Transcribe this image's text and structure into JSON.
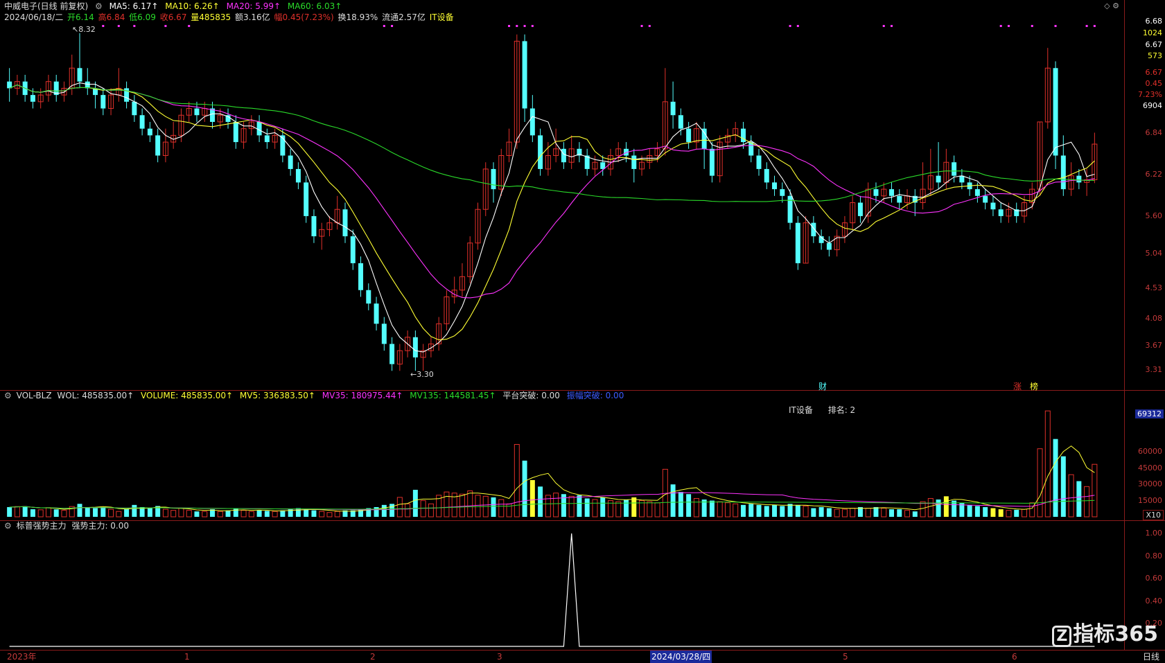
{
  "main_header": {
    "stock_name": "中威电子(日线 前复权)",
    "ma5": "MA5: 6.17↑",
    "ma10": "MA10: 6.26↑",
    "ma20": "MA20: 5.99↑",
    "ma60": "MA60: 6.03↑",
    "date": "2024/06/18/二",
    "open": "开6.14",
    "high": "高6.84",
    "low": "低6.09",
    "close": "收6.67",
    "volume": "量485835",
    "amount": "额3.16亿",
    "change": "幅0.45(7.23%)",
    "turnover": "换18.93%",
    "float": "流通2.57亿",
    "sector": "IT设备"
  },
  "vol_header": {
    "name": "VOL-BLZ",
    "wol": "WOL: 485835.00↑",
    "volume": "VOLUME: 485835.00↑",
    "mv5": "MV5: 336383.50↑",
    "mv35": "MV35: 180975.44↑",
    "mv135": "MV135: 144581.45↑",
    "platform": "平台突破: 0.00",
    "other": "振幅突破: 0.00"
  },
  "vol_note": {
    "sector": "IT设备",
    "rank": "排名: 2"
  },
  "ind_header": {
    "name": "标普强势主力",
    "value": "强势主力: 0.00"
  },
  "annotations": {
    "high": "8.32",
    "low": "3.30",
    "cai": "财",
    "zhang": "涨",
    "bang": "榜"
  },
  "right_axis": {
    "top_price": "6.68",
    "top_count": "1024",
    "p2": "6.67",
    "p2b": "573",
    "p3": "6.67",
    "p3b": "0.45",
    "p3c": "7.23%",
    "vol_now": "6904",
    "vol_marker": "69312",
    "vol_mult": "X10",
    "period": "日线"
  },
  "price_ticks": [
    "6.84",
    "6.22",
    "5.60",
    "5.04",
    "4.53",
    "4.08",
    "3.67",
    "3.31"
  ],
  "vol_ticks": [
    "60000",
    "45000",
    "30000",
    "15000"
  ],
  "ind_ticks": [
    "1.00",
    "0.80",
    "0.60",
    "0.40",
    "0.20"
  ],
  "time_axis": {
    "labels": [
      "2023年",
      "1",
      "2",
      "3",
      "2024/03/28/四",
      "5",
      "6"
    ]
  },
  "logo": "指标365",
  "colors": {
    "up": "#e0302a",
    "down": "#54ffff",
    "ma5": "#ffffff",
    "ma10": "#ffff33",
    "ma20": "#ff33ff",
    "ma60": "#2adb2a",
    "volyellow": "#ffff33"
  },
  "chart_data": {
    "type": "candlestick",
    "title": "中威电子(日线 前复权)",
    "ylim": [
      3.2,
      8.4
    ],
    "bars": [
      {
        "o": 7.6,
        "c": 7.5,
        "h": 7.8,
        "l": 7.3,
        "v": 9000
      },
      {
        "o": 7.5,
        "c": 7.6,
        "h": 7.7,
        "l": 7.4,
        "v": 9500
      },
      {
        "o": 7.6,
        "c": 7.4,
        "h": 7.7,
        "l": 7.3,
        "v": 9800
      },
      {
        "o": 7.4,
        "c": 7.3,
        "h": 7.5,
        "l": 7.2,
        "v": 7000
      },
      {
        "o": 7.3,
        "c": 7.4,
        "h": 7.5,
        "l": 7.2,
        "v": 6500
      },
      {
        "o": 7.4,
        "c": 7.6,
        "h": 7.7,
        "l": 7.3,
        "v": 8500
      },
      {
        "o": 7.6,
        "c": 7.4,
        "h": 7.7,
        "l": 7.3,
        "v": 6900
      },
      {
        "o": 7.4,
        "c": 7.5,
        "h": 7.6,
        "l": 7.3,
        "v": 6000
      },
      {
        "o": 7.5,
        "c": 7.8,
        "h": 8.0,
        "l": 7.4,
        "v": 9500
      },
      {
        "o": 7.8,
        "c": 7.6,
        "h": 8.32,
        "l": 7.5,
        "v": 12000
      },
      {
        "o": 7.6,
        "c": 7.5,
        "h": 7.8,
        "l": 7.4,
        "v": 9000
      },
      {
        "o": 7.5,
        "c": 7.4,
        "h": 7.6,
        "l": 7.2,
        "v": 8000
      },
      {
        "o": 7.4,
        "c": 7.2,
        "h": 7.5,
        "l": 7.1,
        "v": 9000
      },
      {
        "o": 7.2,
        "c": 7.4,
        "h": 7.5,
        "l": 7.1,
        "v": 7000
      },
      {
        "o": 7.4,
        "c": 7.5,
        "h": 7.8,
        "l": 7.3,
        "v": 5000
      },
      {
        "o": 7.5,
        "c": 7.3,
        "h": 7.6,
        "l": 7.2,
        "v": 7000
      },
      {
        "o": 7.3,
        "c": 7.1,
        "h": 7.4,
        "l": 7.0,
        "v": 11000
      },
      {
        "o": 7.1,
        "c": 6.9,
        "h": 7.2,
        "l": 6.8,
        "v": 9000
      },
      {
        "o": 6.9,
        "c": 6.8,
        "h": 7.0,
        "l": 6.7,
        "v": 8000
      },
      {
        "o": 6.8,
        "c": 6.5,
        "h": 6.9,
        "l": 6.4,
        "v": 10000
      },
      {
        "o": 6.5,
        "c": 6.7,
        "h": 6.9,
        "l": 6.4,
        "v": 7000
      },
      {
        "o": 6.7,
        "c": 6.8,
        "h": 7.0,
        "l": 6.6,
        "v": 6000
      },
      {
        "o": 6.8,
        "c": 7.1,
        "h": 7.2,
        "l": 6.7,
        "v": 8000
      },
      {
        "o": 7.1,
        "c": 7.2,
        "h": 7.3,
        "l": 7.0,
        "v": 6000
      },
      {
        "o": 7.2,
        "c": 7.1,
        "h": 7.3,
        "l": 7.0,
        "v": 5000
      },
      {
        "o": 7.1,
        "c": 7.2,
        "h": 7.3,
        "l": 7.0,
        "v": 5000
      },
      {
        "o": 7.2,
        "c": 7.0,
        "h": 7.3,
        "l": 6.9,
        "v": 7000
      },
      {
        "o": 7.0,
        "c": 7.1,
        "h": 7.2,
        "l": 6.9,
        "v": 5000
      },
      {
        "o": 7.1,
        "c": 7.0,
        "h": 7.2,
        "l": 6.9,
        "v": 6000
      },
      {
        "o": 7.0,
        "c": 6.7,
        "h": 7.1,
        "l": 6.6,
        "v": 8000
      },
      {
        "o": 6.7,
        "c": 6.9,
        "h": 7.0,
        "l": 6.6,
        "v": 6000
      },
      {
        "o": 6.9,
        "c": 7.0,
        "h": 7.1,
        "l": 6.8,
        "v": 5000
      },
      {
        "o": 7.0,
        "c": 6.8,
        "h": 7.1,
        "l": 6.7,
        "v": 6000
      },
      {
        "o": 6.8,
        "c": 6.7,
        "h": 6.9,
        "l": 6.6,
        "v": 5500
      },
      {
        "o": 6.7,
        "c": 6.8,
        "h": 6.9,
        "l": 6.6,
        "v": 5000
      },
      {
        "o": 6.8,
        "c": 6.5,
        "h": 6.9,
        "l": 6.4,
        "v": 6000
      },
      {
        "o": 6.5,
        "c": 6.3,
        "h": 6.6,
        "l": 6.2,
        "v": 7000
      },
      {
        "o": 6.3,
        "c": 6.1,
        "h": 6.4,
        "l": 6.0,
        "v": 8000
      },
      {
        "o": 6.1,
        "c": 5.6,
        "h": 6.2,
        "l": 5.5,
        "v": 7000
      },
      {
        "o": 5.6,
        "c": 5.3,
        "h": 5.7,
        "l": 5.2,
        "v": 6000
      },
      {
        "o": 5.3,
        "c": 5.4,
        "h": 5.5,
        "l": 5.1,
        "v": 5000
      },
      {
        "o": 5.4,
        "c": 5.5,
        "h": 5.6,
        "l": 5.3,
        "v": 4000
      },
      {
        "o": 5.5,
        "c": 5.7,
        "h": 5.9,
        "l": 5.4,
        "v": 5000
      },
      {
        "o": 5.7,
        "c": 5.3,
        "h": 5.8,
        "l": 5.2,
        "v": 6000
      },
      {
        "o": 5.3,
        "c": 4.9,
        "h": 5.4,
        "l": 4.8,
        "v": 6000
      },
      {
        "o": 4.9,
        "c": 4.5,
        "h": 5.0,
        "l": 4.4,
        "v": 7000
      },
      {
        "o": 4.5,
        "c": 4.3,
        "h": 4.6,
        "l": 4.2,
        "v": 8000
      },
      {
        "o": 4.3,
        "c": 4.0,
        "h": 4.4,
        "l": 3.9,
        "v": 9000
      },
      {
        "o": 4.0,
        "c": 3.7,
        "h": 4.1,
        "l": 3.6,
        "v": 11000
      },
      {
        "o": 3.7,
        "c": 3.4,
        "h": 3.8,
        "l": 3.3,
        "v": 12000
      },
      {
        "o": 3.4,
        "c": 3.6,
        "h": 3.7,
        "l": 3.3,
        "v": 18000
      },
      {
        "o": 3.6,
        "c": 3.8,
        "h": 3.9,
        "l": 3.5,
        "v": 12000
      },
      {
        "o": 3.8,
        "c": 3.5,
        "h": 3.9,
        "l": 3.3,
        "v": 25000
      },
      {
        "o": 3.5,
        "c": 3.6,
        "h": 3.7,
        "l": 3.3,
        "v": 15000
      },
      {
        "o": 3.6,
        "c": 3.7,
        "h": 3.8,
        "l": 3.5,
        "v": 12000
      },
      {
        "o": 3.7,
        "c": 4.0,
        "h": 4.1,
        "l": 3.6,
        "v": 20000
      },
      {
        "o": 4.0,
        "c": 4.4,
        "h": 4.5,
        "l": 3.9,
        "v": 23000
      },
      {
        "o": 4.4,
        "c": 4.5,
        "h": 4.7,
        "l": 4.3,
        "v": 22000
      },
      {
        "o": 4.5,
        "c": 4.7,
        "h": 4.9,
        "l": 4.4,
        "v": 21000
      },
      {
        "o": 4.7,
        "c": 5.2,
        "h": 5.3,
        "l": 4.6,
        "v": 24000
      },
      {
        "o": 5.2,
        "c": 5.7,
        "h": 5.8,
        "l": 5.1,
        "v": 20000
      },
      {
        "o": 5.7,
        "c": 6.3,
        "h": 6.4,
        "l": 5.6,
        "v": 19000
      },
      {
        "o": 6.3,
        "c": 6.0,
        "h": 6.4,
        "l": 5.8,
        "v": 18000
      },
      {
        "o": 6.0,
        "c": 6.5,
        "h": 6.6,
        "l": 5.9,
        "v": 16000
      },
      {
        "o": 6.5,
        "c": 6.7,
        "h": 6.9,
        "l": 6.4,
        "v": 12000
      },
      {
        "o": 6.7,
        "c": 8.2,
        "h": 8.3,
        "l": 6.6,
        "v": 67000
      },
      {
        "o": 8.2,
        "c": 7.2,
        "h": 8.3,
        "l": 7.0,
        "v": 52000
      },
      {
        "o": 7.2,
        "c": 6.8,
        "h": 7.4,
        "l": 6.7,
        "v": 34000
      },
      {
        "o": 6.8,
        "c": 6.3,
        "h": 6.9,
        "l": 6.2,
        "v": 28000
      },
      {
        "o": 6.3,
        "c": 6.5,
        "h": 6.7,
        "l": 6.2,
        "v": 20000
      },
      {
        "o": 6.5,
        "c": 6.6,
        "h": 6.9,
        "l": 6.4,
        "v": 22000
      },
      {
        "o": 6.6,
        "c": 6.4,
        "h": 6.7,
        "l": 6.3,
        "v": 21000
      },
      {
        "o": 6.4,
        "c": 6.6,
        "h": 6.8,
        "l": 6.3,
        "v": 19000
      },
      {
        "o": 6.6,
        "c": 6.5,
        "h": 6.7,
        "l": 6.4,
        "v": 20000
      },
      {
        "o": 6.5,
        "c": 6.3,
        "h": 6.6,
        "l": 6.2,
        "v": 17000
      },
      {
        "o": 6.3,
        "c": 6.4,
        "h": 6.5,
        "l": 6.2,
        "v": 16000
      },
      {
        "o": 6.4,
        "c": 6.3,
        "h": 6.5,
        "l": 6.2,
        "v": 18000
      },
      {
        "o": 6.3,
        "c": 6.5,
        "h": 6.6,
        "l": 6.2,
        "v": 15000
      },
      {
        "o": 6.5,
        "c": 6.6,
        "h": 6.7,
        "l": 6.4,
        "v": 14000
      },
      {
        "o": 6.6,
        "c": 6.5,
        "h": 6.7,
        "l": 6.4,
        "v": 16000
      },
      {
        "o": 6.5,
        "c": 6.3,
        "h": 6.6,
        "l": 6.1,
        "v": 18000
      },
      {
        "o": 6.3,
        "c": 6.4,
        "h": 6.5,
        "l": 6.2,
        "v": 15000
      },
      {
        "o": 6.4,
        "c": 6.5,
        "h": 6.6,
        "l": 6.3,
        "v": 14000
      },
      {
        "o": 6.5,
        "c": 6.6,
        "h": 6.7,
        "l": 6.4,
        "v": 13000
      },
      {
        "o": 6.6,
        "c": 7.3,
        "h": 7.8,
        "l": 6.5,
        "v": 44000
      },
      {
        "o": 7.3,
        "c": 7.1,
        "h": 7.6,
        "l": 6.9,
        "v": 30000
      },
      {
        "o": 7.1,
        "c": 6.9,
        "h": 7.2,
        "l": 6.8,
        "v": 23000
      },
      {
        "o": 6.9,
        "c": 6.7,
        "h": 7.0,
        "l": 6.6,
        "v": 21000
      },
      {
        "o": 6.7,
        "c": 6.9,
        "h": 7.0,
        "l": 6.6,
        "v": 17000
      },
      {
        "o": 6.9,
        "c": 6.6,
        "h": 7.0,
        "l": 6.3,
        "v": 16000
      },
      {
        "o": 6.6,
        "c": 6.2,
        "h": 6.7,
        "l": 6.1,
        "v": 15000
      },
      {
        "o": 6.2,
        "c": 6.7,
        "h": 6.8,
        "l": 6.1,
        "v": 14000
      },
      {
        "o": 6.7,
        "c": 6.8,
        "h": 6.9,
        "l": 6.6,
        "v": 13000
      },
      {
        "o": 6.8,
        "c": 6.9,
        "h": 7.0,
        "l": 6.7,
        "v": 12000
      },
      {
        "o": 6.9,
        "c": 6.7,
        "h": 7.0,
        "l": 6.6,
        "v": 11000
      },
      {
        "o": 6.7,
        "c": 6.5,
        "h": 6.8,
        "l": 6.4,
        "v": 12000
      },
      {
        "o": 6.5,
        "c": 6.3,
        "h": 6.6,
        "l": 6.2,
        "v": 11000
      },
      {
        "o": 6.3,
        "c": 6.1,
        "h": 6.4,
        "l": 6.0,
        "v": 10000
      },
      {
        "o": 6.1,
        "c": 6.0,
        "h": 6.2,
        "l": 5.9,
        "v": 11000
      },
      {
        "o": 6.0,
        "c": 5.9,
        "h": 6.1,
        "l": 5.8,
        "v": 10000
      },
      {
        "o": 5.9,
        "c": 5.5,
        "h": 6.0,
        "l": 5.4,
        "v": 12000
      },
      {
        "o": 5.5,
        "c": 4.9,
        "h": 5.6,
        "l": 4.8,
        "v": 11000
      },
      {
        "o": 4.9,
        "c": 5.5,
        "h": 5.6,
        "l": 4.9,
        "v": 10000
      },
      {
        "o": 5.5,
        "c": 5.3,
        "h": 5.6,
        "l": 5.2,
        "v": 8000
      },
      {
        "o": 5.3,
        "c": 5.2,
        "h": 5.4,
        "l": 5.1,
        "v": 9000
      },
      {
        "o": 5.2,
        "c": 5.1,
        "h": 5.3,
        "l": 5.0,
        "v": 8000
      },
      {
        "o": 5.1,
        "c": 5.3,
        "h": 5.4,
        "l": 5.0,
        "v": 7000
      },
      {
        "o": 5.3,
        "c": 5.5,
        "h": 5.6,
        "l": 5.2,
        "v": 7000
      },
      {
        "o": 5.5,
        "c": 5.8,
        "h": 5.9,
        "l": 5.4,
        "v": 8000
      },
      {
        "o": 5.8,
        "c": 5.6,
        "h": 5.9,
        "l": 5.5,
        "v": 9000
      },
      {
        "o": 5.6,
        "c": 6.0,
        "h": 6.1,
        "l": 5.5,
        "v": 8000
      },
      {
        "o": 6.0,
        "c": 5.9,
        "h": 6.1,
        "l": 5.8,
        "v": 9000
      },
      {
        "o": 5.9,
        "c": 6.0,
        "h": 6.1,
        "l": 5.8,
        "v": 8000
      },
      {
        "o": 6.0,
        "c": 5.9,
        "h": 6.1,
        "l": 5.8,
        "v": 7000
      },
      {
        "o": 5.9,
        "c": 5.8,
        "h": 6.0,
        "l": 5.7,
        "v": 7000
      },
      {
        "o": 5.8,
        "c": 5.9,
        "h": 6.0,
        "l": 5.7,
        "v": 6000
      },
      {
        "o": 5.9,
        "c": 5.8,
        "h": 6.0,
        "l": 5.6,
        "v": 5000
      },
      {
        "o": 5.8,
        "c": 6.0,
        "h": 6.4,
        "l": 5.7,
        "v": 14000
      },
      {
        "o": 6.0,
        "c": 6.2,
        "h": 6.6,
        "l": 5.9,
        "v": 17000
      },
      {
        "o": 6.2,
        "c": 6.1,
        "h": 6.7,
        "l": 6.0,
        "v": 16000
      },
      {
        "o": 6.1,
        "c": 6.4,
        "h": 6.6,
        "l": 6.0,
        "v": 19000
      },
      {
        "o": 6.4,
        "c": 6.2,
        "h": 6.5,
        "l": 6.1,
        "v": 15000
      },
      {
        "o": 6.2,
        "c": 6.1,
        "h": 6.3,
        "l": 6.0,
        "v": 13000
      },
      {
        "o": 6.1,
        "c": 6.0,
        "h": 6.2,
        "l": 5.9,
        "v": 11000
      },
      {
        "o": 6.0,
        "c": 5.9,
        "h": 6.1,
        "l": 5.8,
        "v": 10000
      },
      {
        "o": 5.9,
        "c": 5.8,
        "h": 6.0,
        "l": 5.7,
        "v": 9000
      },
      {
        "o": 5.8,
        "c": 5.7,
        "h": 5.9,
        "l": 5.6,
        "v": 8000
      },
      {
        "o": 5.7,
        "c": 5.6,
        "h": 5.8,
        "l": 5.5,
        "v": 7000
      },
      {
        "o": 5.6,
        "c": 5.7,
        "h": 5.8,
        "l": 5.5,
        "v": 6000
      },
      {
        "o": 5.7,
        "c": 5.6,
        "h": 5.8,
        "l": 5.5,
        "v": 6500
      },
      {
        "o": 5.6,
        "c": 5.8,
        "h": 5.9,
        "l": 5.5,
        "v": 7000
      },
      {
        "o": 5.8,
        "c": 6.0,
        "h": 6.1,
        "l": 5.7,
        "v": 13000
      },
      {
        "o": 6.0,
        "c": 7.0,
        "h": 7.0,
        "l": 5.9,
        "v": 63000
      },
      {
        "o": 7.0,
        "c": 7.8,
        "h": 8.1,
        "l": 6.9,
        "v": 98000
      },
      {
        "o": 7.8,
        "c": 6.5,
        "h": 7.9,
        "l": 6.3,
        "v": 72000
      },
      {
        "o": 6.5,
        "c": 6.0,
        "h": 6.8,
        "l": 5.9,
        "v": 56000
      },
      {
        "o": 6.0,
        "c": 6.2,
        "h": 6.4,
        "l": 5.9,
        "v": 39000
      },
      {
        "o": 6.2,
        "c": 6.1,
        "h": 6.3,
        "l": 6.0,
        "v": 33000
      },
      {
        "o": 6.1,
        "c": 6.14,
        "h": 6.3,
        "l": 5.9,
        "v": 28000
      },
      {
        "o": 6.14,
        "c": 6.67,
        "h": 6.84,
        "l": 6.09,
        "v": 48583
      }
    ],
    "indicator": {
      "name": "强势主力",
      "peak_index": 72,
      "peak_value": 1.0
    }
  }
}
